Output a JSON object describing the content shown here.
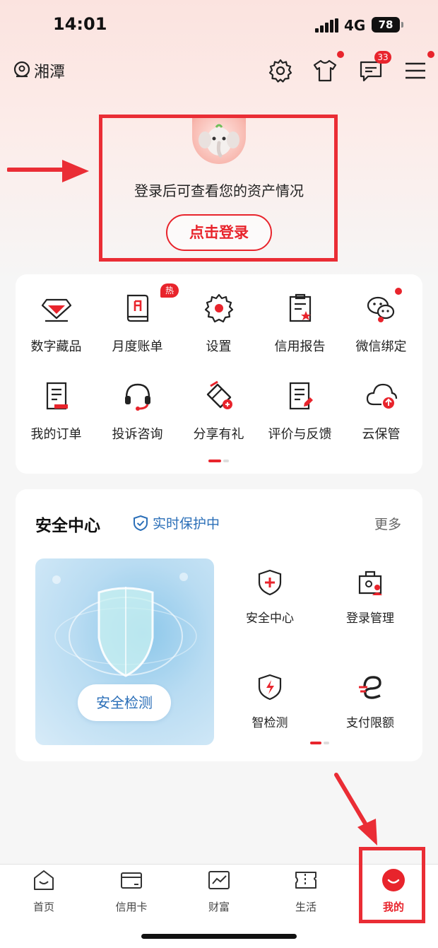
{
  "status_bar": {
    "time": "14:01",
    "network": "4G",
    "battery": "78"
  },
  "header": {
    "location": "湘潭",
    "icons": [
      "settings-icon",
      "tshirt-icon",
      "message-icon",
      "menu-icon"
    ],
    "message_count": "33"
  },
  "login": {
    "prompt": "登录后可查看您的资产情况",
    "button_label": "点击登录"
  },
  "functions": {
    "hot_badge": "热",
    "items": [
      {
        "label": "数字藏品",
        "icon": "diamond-icon"
      },
      {
        "label": "月度账单",
        "icon": "monthly-bill-icon"
      },
      {
        "label": "设置",
        "icon": "gear-icon"
      },
      {
        "label": "信用报告",
        "icon": "credit-report-icon"
      },
      {
        "label": "微信绑定",
        "icon": "wechat-icon"
      },
      {
        "label": "我的订单",
        "icon": "order-icon"
      },
      {
        "label": "投诉咨询",
        "icon": "headset-icon"
      },
      {
        "label": "分享有礼",
        "icon": "share-gift-icon"
      },
      {
        "label": "评价与反馈",
        "icon": "feedback-icon"
      },
      {
        "label": "云保管",
        "icon": "cloud-icon"
      }
    ]
  },
  "security": {
    "title": "安全中心",
    "status": "实时保护中",
    "more": "更多",
    "detect_button": "安全检测",
    "items": [
      {
        "label": "安全中心",
        "icon": "shield-plus-icon"
      },
      {
        "label": "登录管理",
        "icon": "login-manage-icon"
      },
      {
        "label": "智检测",
        "icon": "smart-detect-icon"
      },
      {
        "label": "支付限额",
        "icon": "pay-limit-icon"
      }
    ]
  },
  "tabs": [
    {
      "label": "首页",
      "icon": "home-icon"
    },
    {
      "label": "信用卡",
      "icon": "credit-card-icon"
    },
    {
      "label": "财富",
      "icon": "wealth-chart-icon"
    },
    {
      "label": "生活",
      "icon": "ticket-icon"
    },
    {
      "label": "我的",
      "icon": "profile-icon"
    }
  ],
  "colors": {
    "accent": "#e8242c",
    "annotation": "#ea2d35",
    "secure_blue": "#2b6fb8"
  }
}
